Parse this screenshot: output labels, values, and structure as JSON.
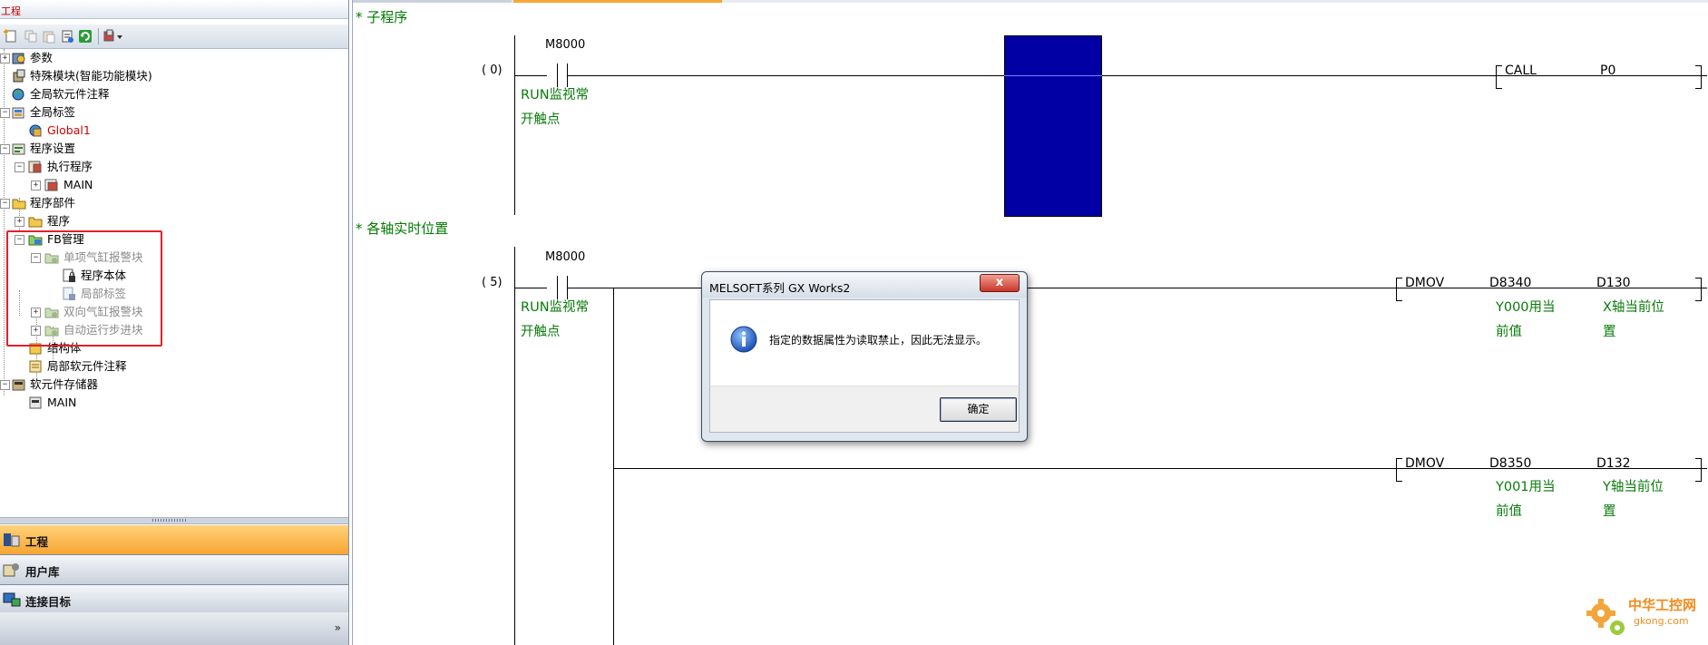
{
  "left_pane": {
    "title": "工程",
    "tree": [
      {
        "label": "参数",
        "icon": "parameter-icon"
      },
      {
        "label": "特殊模块(智能功能模块)",
        "icon": "special-module-icon"
      },
      {
        "label": "全局软元件注释",
        "icon": "global-comment-icon"
      },
      {
        "label": "全局标签",
        "icon": "global-label-icon"
      },
      {
        "label": "Global1",
        "icon": "label-item-icon"
      },
      {
        "label": "程序设置",
        "icon": "program-setting-icon"
      },
      {
        "label": "执行程序",
        "icon": "execute-program-icon"
      },
      {
        "label": "MAIN",
        "icon": "program-icon"
      },
      {
        "label": "程序部件",
        "icon": "program-parts-icon"
      },
      {
        "label": "程序",
        "icon": "folder-icon"
      },
      {
        "label": "FB管理",
        "icon": "fb-manage-icon"
      },
      {
        "label": "单项气缸报警块",
        "icon": "fb-icon"
      },
      {
        "label": "程序本体",
        "icon": "locked-doc-icon"
      },
      {
        "label": "局部标签",
        "icon": "locked-doc-icon"
      },
      {
        "label": "双向气缸报警块",
        "icon": "fb-icon"
      },
      {
        "label": "自动运行步进块",
        "icon": "fb-icon"
      },
      {
        "label": "结构体",
        "icon": "struct-icon"
      },
      {
        "label": "局部软元件注释",
        "icon": "local-comment-icon"
      },
      {
        "label": "软元件存储器",
        "icon": "device-memory-icon"
      },
      {
        "label": "MAIN",
        "icon": "memory-item-icon"
      }
    ],
    "nav": [
      {
        "label": "工程",
        "icon": "project-icon",
        "active": true
      },
      {
        "label": "用户库",
        "icon": "user-library-icon",
        "active": false
      },
      {
        "label": "连接目标",
        "icon": "connection-icon",
        "active": false
      }
    ],
    "overflow": "»"
  },
  "ladder": {
    "statement1": "* 子程序",
    "statement2": "* 各轴实时位置",
    "rung1": {
      "step": "(   0)",
      "contact": "M8000",
      "comment1": "RUN监视常",
      "comment2": "开触点",
      "instr": "CALL",
      "operand": "P0"
    },
    "rung2": {
      "step": "(   5)",
      "contact": "M8000",
      "comment1": "RUN监视常",
      "comment2": "开触点",
      "instr1": "DMOV",
      "src1": "D8340",
      "dst1": "D130",
      "src1_c1": "Y000用当",
      "src1_c2": "前值",
      "dst1_c1": "X轴当前位",
      "dst1_c2": "置",
      "instr2": "DMOV",
      "src2": "D8350",
      "dst2": "D132",
      "src2_c1": "Y001用当",
      "src2_c2": "前值",
      "dst2_c1": "Y轴当前位",
      "dst2_c2": "置"
    }
  },
  "dialog": {
    "title": "MELSOFT系列 GX Works2",
    "close": "x",
    "message": "指定的数据属性为读取禁止，因此无法显示。",
    "ok": "确定"
  },
  "watermark": {
    "cn": "中华工控网",
    "url": "gkong.com"
  },
  "colors": {
    "cursor": "#0000a4",
    "comment_green": "#0a7a0a",
    "active_nav": "#f7a632",
    "highlight_red": "#e3202a"
  }
}
